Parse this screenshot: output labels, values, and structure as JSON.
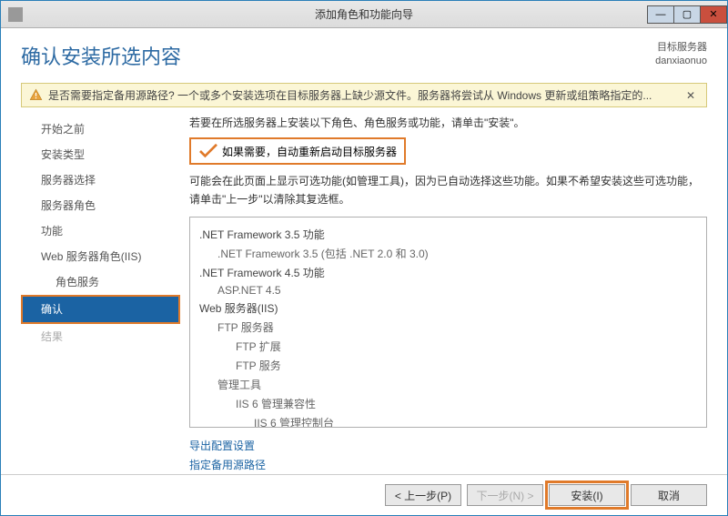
{
  "window": {
    "title": "添加角色和功能向导"
  },
  "heading": "确认安装所选内容",
  "target": {
    "label": "目标服务器",
    "value": "danxiaonuo"
  },
  "warning": {
    "text": "是否需要指定备用源路径? 一个或多个安装选项在目标服务器上缺少源文件。服务器将尝试从 Windows 更新或组策略指定的..."
  },
  "intro": "若要在所选服务器上安装以下角色、角色服务或功能，请单击\"安装\"。",
  "restart_label": "如果需要，自动重新启动目标服务器",
  "desc": "可能会在此页面上显示可选功能(如管理工具)，因为已自动选择这些功能。如果不希望安装这些可选功能，请单击\"上一步\"以清除其复选框。",
  "features": [
    {
      "text": ".NET Framework 3.5 功能",
      "indent": 0
    },
    {
      "text": ".NET Framework 3.5 (包括 .NET 2.0 和 3.0)",
      "indent": 1
    },
    {
      "text": ".NET Framework 4.5 功能",
      "indent": 0
    },
    {
      "text": "ASP.NET 4.5",
      "indent": 1
    },
    {
      "text": "Web 服务器(IIS)",
      "indent": 0
    },
    {
      "text": "FTP 服务器",
      "indent": 1
    },
    {
      "text": "FTP 扩展",
      "indent": 2
    },
    {
      "text": "FTP 服务",
      "indent": 2
    },
    {
      "text": "管理工具",
      "indent": 1
    },
    {
      "text": "IIS 6 管理兼容性",
      "indent": 2
    },
    {
      "text": "IIS 6 管理控制台",
      "indent": 3
    }
  ],
  "links": {
    "export": "导出配置设置",
    "alt_source": "指定备用源路径"
  },
  "sidebar": {
    "items": [
      {
        "label": "开始之前"
      },
      {
        "label": "安装类型"
      },
      {
        "label": "服务器选择"
      },
      {
        "label": "服务器角色"
      },
      {
        "label": "功能"
      },
      {
        "label": "Web 服务器角色(IIS)"
      },
      {
        "label": "角色服务"
      },
      {
        "label": "确认"
      },
      {
        "label": "结果"
      }
    ]
  },
  "buttons": {
    "prev": "< 上一步(P)",
    "next": "下一步(N) >",
    "install": "安装(I)",
    "cancel": "取消"
  }
}
